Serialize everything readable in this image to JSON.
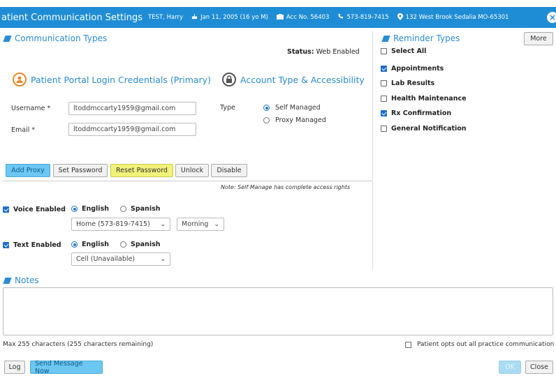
{
  "header": {
    "title": "atient Communication Settings",
    "patient_name": "TEST, Harry",
    "dob": "Jan 11, 2005 (16 yo M)",
    "acc": "Acc No. 56403",
    "phone": "573-819-7415",
    "address": "132 West Brook Sedalia MO-65301"
  },
  "communication_types": {
    "title": "Communication Types",
    "status_label": "Status:",
    "status_value": "Web Enabled"
  },
  "portal": {
    "title": "Patient Portal Login Credentials (Primary)",
    "username_label": "Username *",
    "username_value": "ltoddmccarty1959@gmail.com",
    "email_label": "Email *",
    "email_value": "ltoddmccarty1959@gmail.com"
  },
  "account": {
    "title": "Account Type & Accessibility",
    "type_label": "Type",
    "options": [
      "Self Managed",
      "Proxy Managed"
    ],
    "selected": "Self Managed"
  },
  "buttons": {
    "add_proxy": "Add Proxy",
    "set_password": "Set Password",
    "reset_password": "Reset Password",
    "unlock": "Unlock",
    "disable": "Disable",
    "more": "More",
    "log": "Log",
    "send_message": "Send Message Now",
    "ok": "OK",
    "close": "Close"
  },
  "note_self_manage": "Note: Self Manage has complete access rights",
  "voice": {
    "label": "Voice Enabled",
    "checked": true,
    "lang_english": "English",
    "lang_spanish": "Spanish",
    "selected_lang": "English",
    "phone_select": "Home (573-819-7415)",
    "time_select": "Morning"
  },
  "text": {
    "label": "Text Enabled",
    "checked": true,
    "lang_english": "English",
    "lang_spanish": "Spanish",
    "selected_lang": "English",
    "phone_select": "Cell (Unavailable)"
  },
  "reminder_types": {
    "title": "Reminder Types",
    "items": [
      {
        "label": "Select All",
        "checked": false
      },
      {
        "label": "Appointments",
        "checked": true
      },
      {
        "label": "Lab Results",
        "checked": false
      },
      {
        "label": "Health Maintenance",
        "checked": false
      },
      {
        "label": "Rx Confirmation",
        "checked": true
      },
      {
        "label": "General Notification",
        "checked": false
      }
    ]
  },
  "notes": {
    "title": "Notes",
    "value": "",
    "char_info": "Max 255 characters (255 characters remaining)",
    "opt_out_label": "Patient opts out all practice communication",
    "opt_out_checked": false
  },
  "colors": {
    "accent": "#1f8dd6",
    "highlight": "#f2f27a",
    "portal_icon": "#e88a2b"
  }
}
